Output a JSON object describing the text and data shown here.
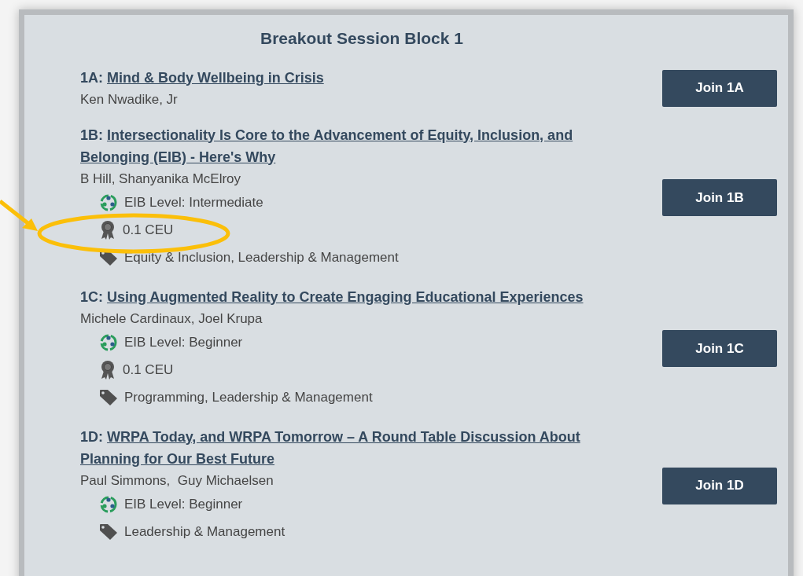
{
  "block_title": "Breakout Session Block 1",
  "sessions": [
    {
      "code": "1A:",
      "title": "Mind & Body Wellbeing in Crisis",
      "speakers": "Ken Nwadike, Jr",
      "button": "Join 1A"
    },
    {
      "code": "1B:",
      "title": "Intersectionality Is Core to the Advancement of Equity, Inclusion, and Belonging (EIB) - Here's Why",
      "speakers": "B Hill, Shanyanika McElroy",
      "meta": [
        {
          "kind": "eib",
          "text": "EIB Level: Intermediate"
        },
        {
          "kind": "ceu",
          "text": "0.1 CEU"
        },
        {
          "kind": "tags",
          "text": "Equity & Inclusion, Leadership & Management"
        }
      ],
      "button": "Join 1B"
    },
    {
      "code": "1C:",
      "title": "Using Augmented Reality to Create Engaging Educational Experiences",
      "speakers": "Michele Cardinaux, Joel Krupa",
      "meta": [
        {
          "kind": "eib",
          "text": "EIB Level: Beginner"
        },
        {
          "kind": "ceu",
          "text": "0.1 CEU"
        },
        {
          "kind": "tags",
          "text": "Programming, Leadership & Management"
        }
      ],
      "button": "Join 1C"
    },
    {
      "code": "1D:",
      "title": "WRPA Today, and WRPA Tomorrow – A Round Table Discussion About Planning for Our Best Future",
      "speakers": "Paul Simmons,  Guy Michaelsen",
      "meta": [
        {
          "kind": "eib",
          "text": "EIB Level: Beginner"
        },
        {
          "kind": "tags",
          "text": "Leadership & Management"
        }
      ],
      "button": "Join 1D"
    }
  ]
}
